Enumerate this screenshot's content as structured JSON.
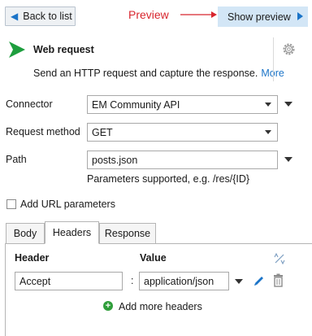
{
  "toolbar": {
    "back_label": "Back to list",
    "annotation": "Preview",
    "preview_label": "Show preview"
  },
  "action": {
    "title": "Web request",
    "description": "Send an HTTP request and capture the response.",
    "more_link": "More"
  },
  "form": {
    "connector_label": "Connector",
    "connector_value": "EM Community API",
    "method_label": "Request method",
    "method_value": "GET",
    "path_label": "Path",
    "path_value": "posts.json",
    "path_hint": "Parameters supported, e.g. /res/{ID}",
    "url_params_label": "Add URL parameters",
    "url_params_checked": false
  },
  "tabs": [
    {
      "label": "Body",
      "active": false
    },
    {
      "label": "Headers",
      "active": true
    },
    {
      "label": "Response",
      "active": false
    }
  ],
  "headers_table": {
    "col_header": "Header",
    "col_value": "Value",
    "rows": [
      {
        "header": "Accept",
        "separator": ":",
        "value": "application/json"
      }
    ],
    "add_label": "Add more headers"
  },
  "colors": {
    "accent": "#1b74c8",
    "annotation": "#d8262e",
    "preview_bg": "#d3e6f6",
    "add_green": "#2f9e3a",
    "flow_green": "#1e9e3e"
  }
}
